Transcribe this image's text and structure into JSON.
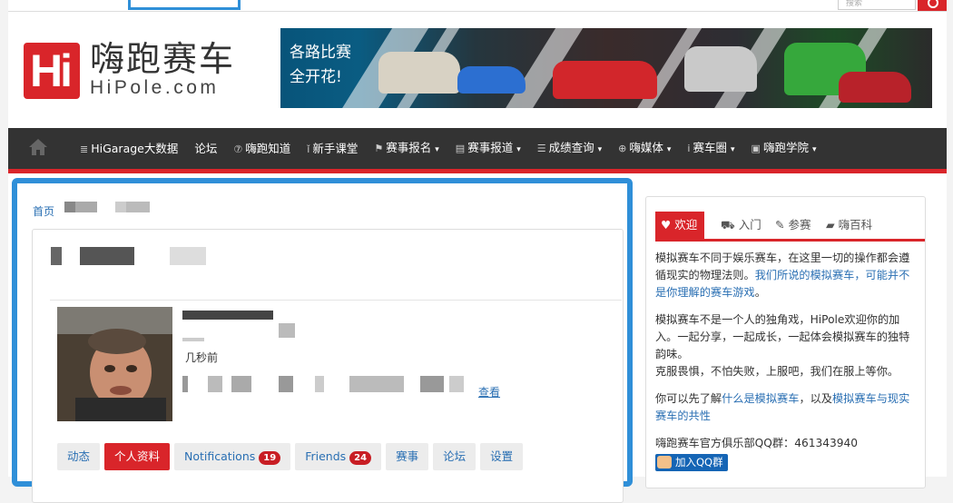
{
  "topbar": {
    "search_placeholder": "搜索"
  },
  "header": {
    "logo_mark": "Hi",
    "logo_cn": "嗨跑赛车",
    "logo_en": "HiPole.com"
  },
  "banner": {
    "line1": "各路比赛",
    "line2": "全开花!"
  },
  "nav": {
    "items": [
      {
        "icon": "≣",
        "label": "HiGarage大数据",
        "caret": false
      },
      {
        "icon": "",
        "label": "论坛",
        "caret": false
      },
      {
        "icon": "⑦",
        "label": "嗨跑知道",
        "caret": false
      },
      {
        "icon": "ǐ",
        "label": "新手课堂",
        "caret": false
      },
      {
        "icon": "⚑",
        "label": "赛事报名",
        "caret": true
      },
      {
        "icon": "▤",
        "label": "赛事报道",
        "caret": true
      },
      {
        "icon": "☰",
        "label": "成绩查询",
        "caret": true
      },
      {
        "icon": "⊕",
        "label": "嗨媒体",
        "caret": true
      },
      {
        "icon": "i",
        "label": "赛车圈",
        "caret": true
      },
      {
        "icon": "▣",
        "label": "嗨跑学院",
        "caret": true
      }
    ]
  },
  "main": {
    "breadcrumb_home": "首页",
    "profile": {
      "time": "几秒前",
      "view_link": "查看"
    },
    "tabs": [
      {
        "label": "动态",
        "active": false,
        "badge": ""
      },
      {
        "label": "个人资料",
        "active": true,
        "badge": ""
      },
      {
        "label": "Notifications",
        "active": false,
        "badge": "19"
      },
      {
        "label": "Friends",
        "active": false,
        "badge": "24"
      },
      {
        "label": "赛事",
        "active": false,
        "badge": ""
      },
      {
        "label": "论坛",
        "active": false,
        "badge": ""
      },
      {
        "label": "设置",
        "active": false,
        "badge": ""
      }
    ]
  },
  "sidebar": {
    "tabs": [
      {
        "icon": "♥",
        "label": "欢迎"
      },
      {
        "icon": "⛟",
        "label": "入门"
      },
      {
        "icon": "✎",
        "label": "参赛"
      },
      {
        "icon": "▰",
        "label": "嗨百科"
      }
    ],
    "para1_a": "模拟赛车不同于娱乐赛车，在这里一切的操作都会遵循现实的物理法则。",
    "para1_link": "我们所说的模拟赛车，可能并不是你理解的赛车游戏",
    "para1_end": "。",
    "para2_a": "模拟赛车不是一个人的独角戏，HiPole欢迎你的加入。一起分享，一起成长，一起体会模拟赛车的独特韵味。",
    "para2_b": "克服畏惧，不怕失败，上服吧，我们在服上等你。",
    "para3_a": "你可以先了解",
    "para3_link1": "什么是模拟赛车",
    "para3_mid": "，以及",
    "para3_link2": "模拟赛车与现实赛车的共性",
    "qq_text": "嗨跑赛车官方俱乐部QQ群：461343940",
    "qq_button": "加入QQ群"
  }
}
